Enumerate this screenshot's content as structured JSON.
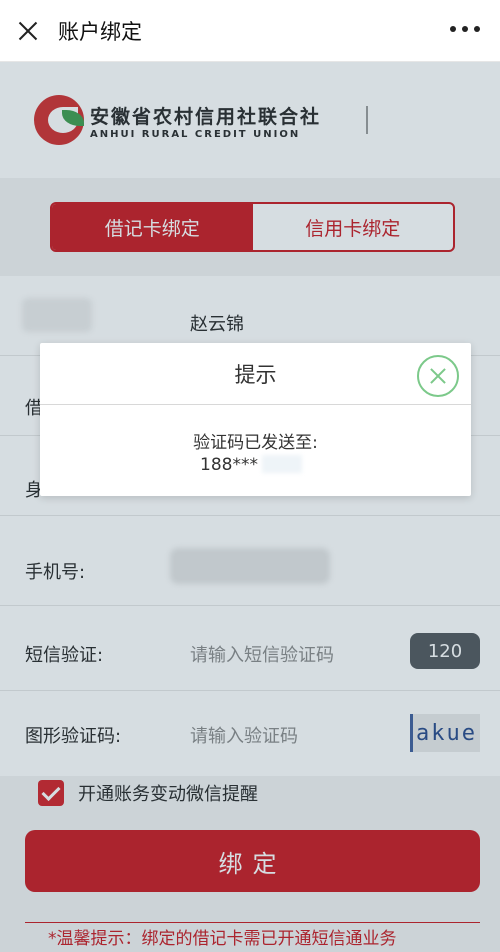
{
  "navbar": {
    "title": "账户绑定"
  },
  "header": {
    "bank_name_cn": "安徽省农村信用社联合社",
    "bank_name_en": "ANHUI RURAL CREDIT UNION"
  },
  "tabs": [
    {
      "label": "借记卡绑定",
      "active": true
    },
    {
      "label": "信用卡绑定",
      "active": false
    }
  ],
  "form": {
    "name_value": "赵云锦",
    "card_label": "借",
    "id_label": "身",
    "phone_label": "手机号:",
    "sms_label": "短信验证:",
    "sms_placeholder": "请输入短信验证码",
    "sms_countdown": "120",
    "captcha_label": "图形验证码:",
    "captcha_placeholder": "请输入验证码",
    "captcha_text": "akue",
    "checkbox_label": "开通账务变动微信提醒",
    "checkbox_checked": true,
    "submit_label": "绑定"
  },
  "tip": "*温馨提示：绑定的借记卡需已开通短信通业务",
  "dialog": {
    "title": "提示",
    "message": "验证码已发送至:",
    "phone_partial": "188***"
  },
  "colors": {
    "brand_red": "#c8121a",
    "logo_green": "#3a9a48",
    "dialog_close_green": "#7cc98a",
    "countdown_bg": "#4e5358"
  },
  "icons": {
    "close": "close-icon",
    "more": "more-dots-icon",
    "dialog_close": "circle-close-icon",
    "check": "checkmark-icon"
  }
}
